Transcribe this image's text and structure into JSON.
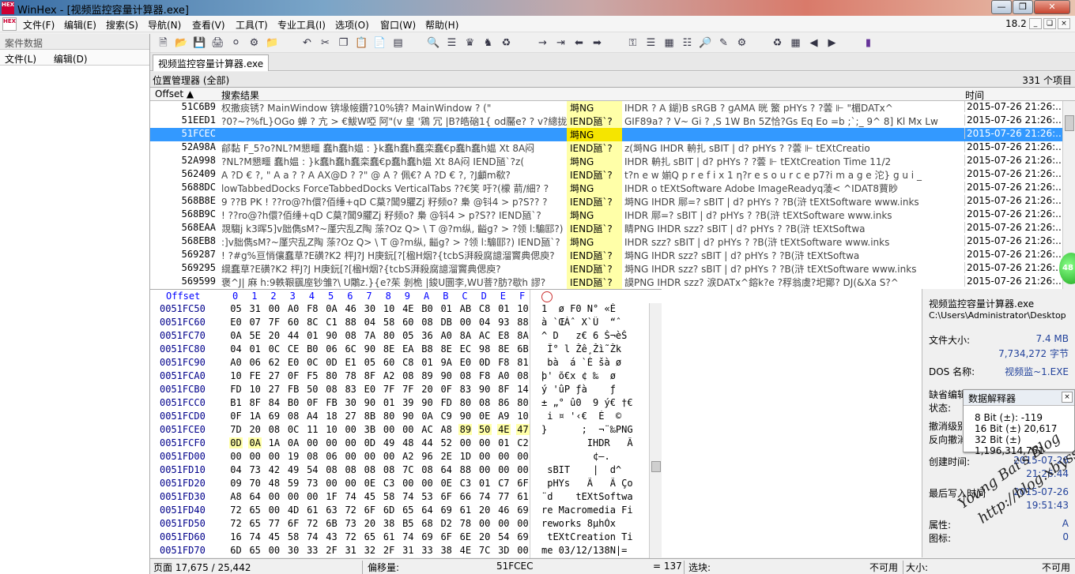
{
  "window": {
    "app": "WinHex",
    "title": "WinHex - [视频监控容量计算器.exe]",
    "version": "18.2",
    "logo_text": "HEX"
  },
  "menu": [
    "文件(F)",
    "编辑(E)",
    "搜索(S)",
    "导航(N)",
    "查看(V)",
    "工具(T)",
    "专业工具(I)",
    "选项(O)",
    "窗口(W)",
    "帮助(H)"
  ],
  "left_panel": {
    "title": "案件数据",
    "items": [
      "文件(L)",
      "编辑(D)"
    ]
  },
  "tab": "视频监控容量计算器.exe",
  "position_manager": {
    "title": "位置管理器 (全部)",
    "count": "331 个项目"
  },
  "results": {
    "headers": {
      "offset": "Offset",
      "context": "搜索结果",
      "time": "时间"
    },
    "rows": [
      {
        "offset": "51C6B9",
        "context": "权撒痰锈?    MainWindow        锛堟帹鑽?10%锛?    MainWindow ?     (\"",
        "hit": "塒NG",
        "rest": "    IHDR   ?  A     鍸)B     sRGB      ?   gAMA  晄  鰵      pHYs    ?  ?蕓 ⊩   \"楣DATx^",
        "time": "2015-07-26   21:26:..."
      },
      {
        "offset": "51EED1",
        "context": "?0?~?%fL}OGo  蝉   ? 亢 > €鮁W啞      阿\"(v 皇 '鶏 冗 |B?皓硇1{     od靨e?  ?  v?總拢",
        "hit": "IEND瓸`?",
        "rest": "   GIF89a?   ?         V~ Gi   ? ,S  1W Bn 5Z恰?Gs Eq Eo =b ;`;_ 9^ 8] Kl Mx Lw",
        "time": "2015-07-26   21:26:..."
      },
      {
        "offset": "51FCEC",
        "context": "",
        "hit": "塒NG",
        "rest": "",
        "time": "2015-07-26   21:26:...",
        "selected": true
      },
      {
        "offset": "52A98A",
        "context": "鄃黏    F_5?o?NL?M懇疅    蠢h蠢h媪    : }k蠢h蠢h蠢栾蠢€p蠢h蠢h媪       Xt  8A闷",
        "hit": "IEND瓸`?",
        "rest": "z(塒NG        IHDR              輈扎       sBIT      | d?    pHYs     ?  ?蕓 ⊩    tEXtCreatio",
        "time": "2015-07-26   21:26:..."
      },
      {
        "offset": "52A998",
        "context": "?NL?M懇疅    蠢h媪    : }k蠢h蠢h蠢栾蠢€p蠢h蠢h媪        Xt  8A闷       IEND瓸`?z(",
        "hit": "塒NG",
        "rest": "      IHDR              輈扎       sBIT      | d?    pHYs     ?  ?蕓 ⊩   tEXtCreation Time 11/2",
        "time": "2015-07-26   21:26:..."
      },
      {
        "offset": "562409",
        "context": "A ?D  €  ?,  \"  A  a     ?  ?  A  AX@D  ?  ?\"  @   A    ?  佩€?  A ?D  €  ?,  ?J顱m欷?",
        "hit": "IEND瓸`?",
        "rest": "         t?n e w   媊Q p r e f i x 1    η?r e s o u r c e   p7?i m a g e   沱} g u i _",
        "time": "2015-07-26   21:26:..."
      },
      {
        "offset": "5688DC",
        "context": "lowTabbedDocks ForceTabbedDocks VerticalTabs    ??€笑 吁?(檬 葥/細?        ?",
        "hit": "塒NG",
        "rest": "    IHDR              o       tEXtSoftware Adobe ImageReadyq蓤<     ^IDAT8蕒眇",
        "time": "2015-07-26   21:26:..."
      },
      {
        "offset": "568B8E",
        "context": "9 ??B    PK ! ??ro@?h儇?佰缍+qD C菒?閶9臞Zj 籽频o?     梟 @钭4 > p?S??        ?",
        "hit": "IEND瓸`?",
        "rest": "   塒NG         IHDR              鄏=?   sBIT     | d?    pHYs     ?  ?B(浒    tEXtSoftware www.inks",
        "time": "2015-07-26   21:26:..."
      },
      {
        "offset": "568B9C",
        "context": "! ??ro@?h儇?佰缍+qD C菒?閶9臞Zj 籽频o?      梟 @钭4 > p?S??          IEND瓸`?",
        "hit": "塒NG",
        "rest": "    IHDR              鄏=?   sBIT     | d?    pHYs     ?  ?B(浒    tEXtSoftware www.inks",
        "time": "2015-07-26   21:26:..."
      },
      {
        "offset": "568EAA",
        "context": "覝騶j k3晖5]v胐儁sM?~厪宍乱Z陶 蒤?Oz Q>     \\   T @?m纵, 齸g? > ?领 l:騸邼?)      ?",
        "hit": "IEND瓸`?",
        "rest": "   睛PNG         IHDR              szz?    sBIT     | d?    pHYs     ?  ?B(浒    tEXtSoftwa",
        "time": "2015-07-26   21:26:..."
      },
      {
        "offset": "568EB8",
        "context": ":]v胐儁sM?~厪宍乱Z陶 蒤?Oz Q>      \\   T @?m纵, 齸g? > ?领 l:騸邼?)         IEND瓸`?",
        "hit": "塒NG",
        "rest": "    IHDR              szz?    sBIT     | d?    pHYs     ?  ?B(浒    tEXtSoftware www.inks",
        "time": "2015-07-26   21:26:..."
      },
      {
        "offset": "569287",
        "context": "! ?#g%亘悄儴蠢草?E磺?K2        枰J?J H庚鈨[?[楹H烟?{tcbS湃殺腐譩溜竇典偲庾?",
        "hit": "IEND瓸`?",
        "rest": "   塒NG         IHDR              szz?    sBIT     | d?    pHYs     ?  ?B(浒    tEXtSoftwa",
        "time": "2015-07-26   21:26:..."
      },
      {
        "offset": "569295",
        "context": "繉蠢草?E磺?K2        枰J?J H庚鈨[?[楹H烟?{tcbS湃殺腐譩溜竇典偲庾?",
        "hit": "IEND瓸`?",
        "rest": "   塒NG         IHDR              szz?    sBIT     | d?    pHYs     ?  ?B(浒    tEXtSoftware www.inks",
        "time": "2015-07-26   21:26:..."
      },
      {
        "offset": "569599",
        "context": "褒^J| 麻     h:9軼鞎颻庢钞雏?\\         U鷴z.}{e?茱 剝桅 |鋑U圜李,WU萻?肪?歇h 謬?",
        "hit": "IEND瓸`?",
        "rest": "   謨PNG         IHDR              szz?  涙DATx^鎔k?e ?稃翁虞?圯鄮?  DJ(&Xa S?^",
        "time": "2015-07-26   21:26:..."
      }
    ]
  },
  "hex": {
    "offset_label": "Offset",
    "columns": [
      "0",
      "1",
      "2",
      "3",
      "4",
      "5",
      "6",
      "7",
      "8",
      "9",
      "A",
      "B",
      "C",
      "D",
      "E",
      "F"
    ],
    "lines": [
      {
        "addr": "0051FC50",
        "bytes": [
          "05",
          "31",
          "00",
          "A0",
          "F8",
          "0A",
          "46",
          "30",
          "10",
          "4E",
          "B0",
          "01",
          "AB",
          "C8",
          "01",
          "10"
        ],
        "text": "1  ø F0 N° «È"
      },
      {
        "addr": "0051FC60",
        "bytes": [
          "E0",
          "07",
          "7F",
          "60",
          "8C",
          "C1",
          "88",
          "04",
          "58",
          "60",
          "08",
          "DB",
          "00",
          "04",
          "93",
          "88"
        ],
        "text": "à `ŒÁˆ X`Û  “ˆ"
      },
      {
        "addr": "0051FC70",
        "bytes": [
          "0A",
          "5E",
          "20",
          "44",
          "01",
          "90",
          "08",
          "7A",
          "80",
          "05",
          "36",
          "A0",
          "8A",
          "AC",
          "E8",
          "8A"
        ],
        "text": "^ D   z€ 6 Š¬èŠ"
      },
      {
        "addr": "0051FC80",
        "bytes": [
          "04",
          "01",
          "0C",
          "CE",
          "B0",
          "06",
          "6C",
          "90",
          "8E",
          "EA",
          "B8",
          "8E",
          "EC",
          "98",
          "8E",
          "6B"
        ],
        "text": " Î° l Žê¸Žì˜Žk"
      },
      {
        "addr": "0051FC90",
        "bytes": [
          "A0",
          "06",
          "62",
          "E0",
          "0C",
          "0D",
          "E1",
          "05",
          "60",
          "C8",
          "01",
          "9A",
          "E0",
          "0D",
          "F8",
          "81"
        ],
        "text": " bà  á `È šà ø"
      },
      {
        "addr": "0051FCA0",
        "bytes": [
          "10",
          "FE",
          "27",
          "0F",
          "F5",
          "80",
          "78",
          "8F",
          "A2",
          "08",
          "89",
          "90",
          "08",
          "F8",
          "A0",
          "08"
        ],
        "text": "þ' õ€x ¢ ‰  ø"
      },
      {
        "addr": "0051FCB0",
        "bytes": [
          "FD",
          "10",
          "27",
          "FB",
          "50",
          "08",
          "83",
          "E0",
          "7F",
          "7F",
          "20",
          "0F",
          "83",
          "90",
          "8F",
          "14"
        ],
        "text": "ý 'ûP ƒà    ƒ"
      },
      {
        "addr": "0051FCC0",
        "bytes": [
          "B1",
          "8F",
          "84",
          "B0",
          "0F",
          "FB",
          "30",
          "90",
          "01",
          "39",
          "90",
          "FD",
          "80",
          "08",
          "86",
          "80"
        ],
        "text": "± „° û0  9 ý€ †€"
      },
      {
        "addr": "0051FCD0",
        "bytes": [
          "0F",
          "1A",
          "69",
          "08",
          "A4",
          "18",
          "27",
          "8B",
          "80",
          "90",
          "0A",
          "C9",
          "90",
          "0E",
          "A9",
          "10"
        ],
        "text": " i ¤ '‹€  É  ©"
      },
      {
        "addr": "0051FCE0",
        "bytes": [
          "7D",
          "20",
          "08",
          "0C",
          "11",
          "10",
          "00",
          "3B",
          "00",
          "00",
          "AC",
          "A8",
          "89",
          "50",
          "4E",
          "47"
        ],
        "text": "}      ;  ¬¨‰PNG",
        "hl_from": 12
      },
      {
        "addr": "0051FCF0",
        "bytes": [
          "0D",
          "0A",
          "1A",
          "0A",
          "00",
          "00",
          "00",
          "0D",
          "49",
          "48",
          "44",
          "52",
          "00",
          "00",
          "01",
          "C2"
        ],
        "text": "        IHDR   Â",
        "hl_to": 1
      },
      {
        "addr": "0051FD00",
        "bytes": [
          "00",
          "00",
          "00",
          "19",
          "08",
          "06",
          "00",
          "00",
          "00",
          "A2",
          "96",
          "2E",
          "1D",
          "00",
          "00",
          "00"
        ],
        "text": "         ¢–."
      },
      {
        "addr": "0051FD10",
        "bytes": [
          "04",
          "73",
          "42",
          "49",
          "54",
          "08",
          "08",
          "08",
          "08",
          "7C",
          "08",
          "64",
          "88",
          "00",
          "00",
          "00"
        ],
        "text": " sBIT    |  d^"
      },
      {
        "addr": "0051FD20",
        "bytes": [
          "09",
          "70",
          "48",
          "59",
          "73",
          "00",
          "00",
          "0E",
          "C3",
          "00",
          "00",
          "0E",
          "C3",
          "01",
          "C7",
          "6F"
        ],
        "text": " pHYs   Ã   Ã Ço"
      },
      {
        "addr": "0051FD30",
        "bytes": [
          "A8",
          "64",
          "00",
          "00",
          "00",
          "1F",
          "74",
          "45",
          "58",
          "74",
          "53",
          "6F",
          "66",
          "74",
          "77",
          "61"
        ],
        "text": "¨d    tEXtSoftwa"
      },
      {
        "addr": "0051FD40",
        "bytes": [
          "72",
          "65",
          "00",
          "4D",
          "61",
          "63",
          "72",
          "6F",
          "6D",
          "65",
          "64",
          "69",
          "61",
          "20",
          "46",
          "69"
        ],
        "text": "re Macromedia Fi"
      },
      {
        "addr": "0051FD50",
        "bytes": [
          "72",
          "65",
          "77",
          "6F",
          "72",
          "6B",
          "73",
          "20",
          "38",
          "B5",
          "68",
          "D2",
          "78",
          "00",
          "00",
          "00"
        ],
        "text": "reworks 8µhÒx"
      },
      {
        "addr": "0051FD60",
        "bytes": [
          "16",
          "74",
          "45",
          "58",
          "74",
          "43",
          "72",
          "65",
          "61",
          "74",
          "69",
          "6F",
          "6E",
          "20",
          "54",
          "69"
        ],
        "text": " tEXtCreation Ti"
      },
      {
        "addr": "0051FD70",
        "bytes": [
          "6D",
          "65",
          "00",
          "30",
          "33",
          "2F",
          "31",
          "32",
          "2F",
          "31",
          "33",
          "38",
          "4E",
          "7C",
          "3D",
          "00"
        ],
        "text": "me 03/12/138N|="
      }
    ]
  },
  "side": {
    "filename": "视频监控容量计算器.exe",
    "path": "C:\\Users\\Administrator\\Desktop",
    "file_size_label": "文件大小:",
    "file_size_mb": "7.4 MB",
    "file_size_bytes": "7,734,272 字节",
    "dos_label": "DOS 名称:",
    "dos_name": "视频监~1.EXE",
    "default_edit": "缺省编辑",
    "state": "状态:",
    "undo": "撤消级别",
    "reverse": "反向撤消",
    "created_label": "创建时间:",
    "created_date": "2015-07-26",
    "created_time": "21:26:44",
    "modified_label": "最后写入时间",
    "modified_date": "2015-07-26",
    "modified_time": "19:51:43",
    "attr_label": "属性:",
    "attr_value": "A",
    "icon_label": "图标:",
    "icon_value": "0"
  },
  "data_interpreter": {
    "title": "数据解释器",
    "lines": [
      "8 Bit (±): -119",
      "16 Bit (±) 20,617",
      "32 Bit (±) 1,196,314,761"
    ]
  },
  "status": {
    "page": "页面 17,675 / 25,442",
    "offset_label": "偏移量:",
    "offset_value": "51FCEC",
    "eq": "= 137",
    "block_label": "选块:",
    "not_used": "不可用",
    "size_label": "大小:",
    "not_used2": "不可用"
  },
  "watermark": {
    "line1": "Young Bai's Blog",
    "line2": "http://blog.xbyss.org"
  },
  "green_ball": "48"
}
